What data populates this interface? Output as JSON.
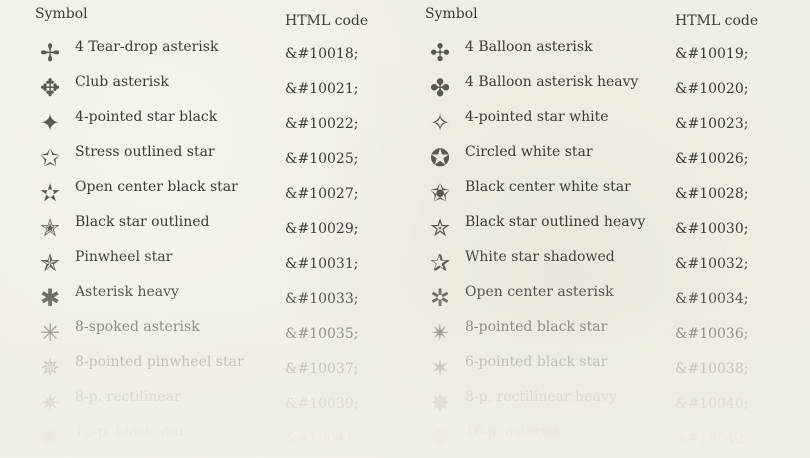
{
  "left": {
    "header_symbol": "Symbol",
    "header_code": "HTML code",
    "rows": [
      {
        "glyph": "✢",
        "name": "4 Tear-drop asterisk",
        "code": "&#10018;"
      },
      {
        "glyph": "✥",
        "name": "Club asterisk",
        "code": "&#10021;"
      },
      {
        "glyph": "✦",
        "name": "4-pointed star black",
        "code": "&#10022;"
      },
      {
        "glyph": "✩",
        "name": "Stress outlined star",
        "code": "&#10025;"
      },
      {
        "glyph": "✫",
        "name": "Open center black star",
        "code": "&#10027;"
      },
      {
        "glyph": "✭",
        "name": "Black star outlined",
        "code": "&#10029;"
      },
      {
        "glyph": "✯",
        "name": "Pinwheel star",
        "code": "&#10031;"
      },
      {
        "glyph": "✱",
        "name": "Asterisk heavy",
        "code": "&#10033;"
      },
      {
        "glyph": "✳",
        "name": "8-spoked asterisk",
        "code": "&#10035;"
      },
      {
        "glyph": "✵",
        "name": "8-pointed pinwheel star",
        "code": "&#10037;"
      },
      {
        "glyph": "✷",
        "name": "8-p. rectilinear",
        "code": "&#10039;"
      },
      {
        "glyph": "✹",
        "name": "12-p. black star",
        "code": "&#10041;"
      }
    ]
  },
  "right": {
    "header_symbol": "Symbol",
    "header_code": "HTML code",
    "rows": [
      {
        "glyph": "✣",
        "name": "4 Balloon asterisk",
        "code": "&#10019;"
      },
      {
        "glyph": "✤",
        "name": "4 Balloon asterisk heavy",
        "code": "&#10020;"
      },
      {
        "glyph": "✧",
        "name": "4-pointed star white",
        "code": "&#10023;"
      },
      {
        "glyph": "✪",
        "name": "Circled white star",
        "code": "&#10026;"
      },
      {
        "glyph": "✬",
        "name": "Black center white star",
        "code": "&#10028;"
      },
      {
        "glyph": "✮",
        "name": "Black star outlined heavy",
        "code": "&#10030;"
      },
      {
        "glyph": "✰",
        "name": "White star shadowed",
        "code": "&#10032;"
      },
      {
        "glyph": "✲",
        "name": "Open center asterisk",
        "code": "&#10034;"
      },
      {
        "glyph": "✴",
        "name": "8-pointed black star",
        "code": "&#10036;"
      },
      {
        "glyph": "✶",
        "name": "6-pointed black star",
        "code": "&#10038;"
      },
      {
        "glyph": "✸",
        "name": "8-p. rectilinear heavy",
        "code": "&#10040;"
      },
      {
        "glyph": "✺",
        "name": "16-p. asterisk",
        "code": "&#10042;"
      }
    ]
  }
}
